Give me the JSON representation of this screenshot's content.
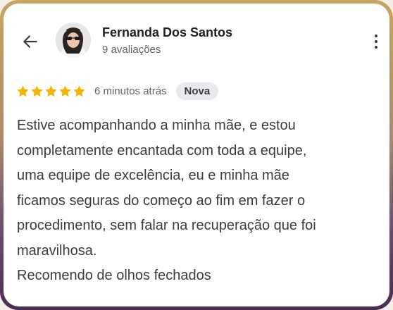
{
  "reviewer": {
    "name": "Fernanda Dos Santos",
    "reviews_count": "9 avaliações",
    "avatar_icon": "user-photo"
  },
  "review": {
    "rating": 5,
    "max_rating": 5,
    "time_ago": "6 minutos atrás",
    "badge": "Nova",
    "lines": [
      "Estive acompanhando a minha mãe, e estou",
      "completamente encantada com toda a equipe,",
      "uma equipe de excelência, eu e minha mãe",
      "ficamos seguras do começo ao fim em fazer o",
      "procedimento, sem falar na recuperação que foi",
      "maravilhosa.",
      "Recomendo de olhos fechados"
    ]
  },
  "icons": {
    "back": "arrow-left-icon",
    "more": "more-vertical-icon",
    "star": "star-icon"
  },
  "colors": {
    "star": "#f5b400",
    "frame_top": "#c8a55f",
    "frame_bottom": "#4a2b55",
    "badge_bg": "#e8eaed"
  }
}
